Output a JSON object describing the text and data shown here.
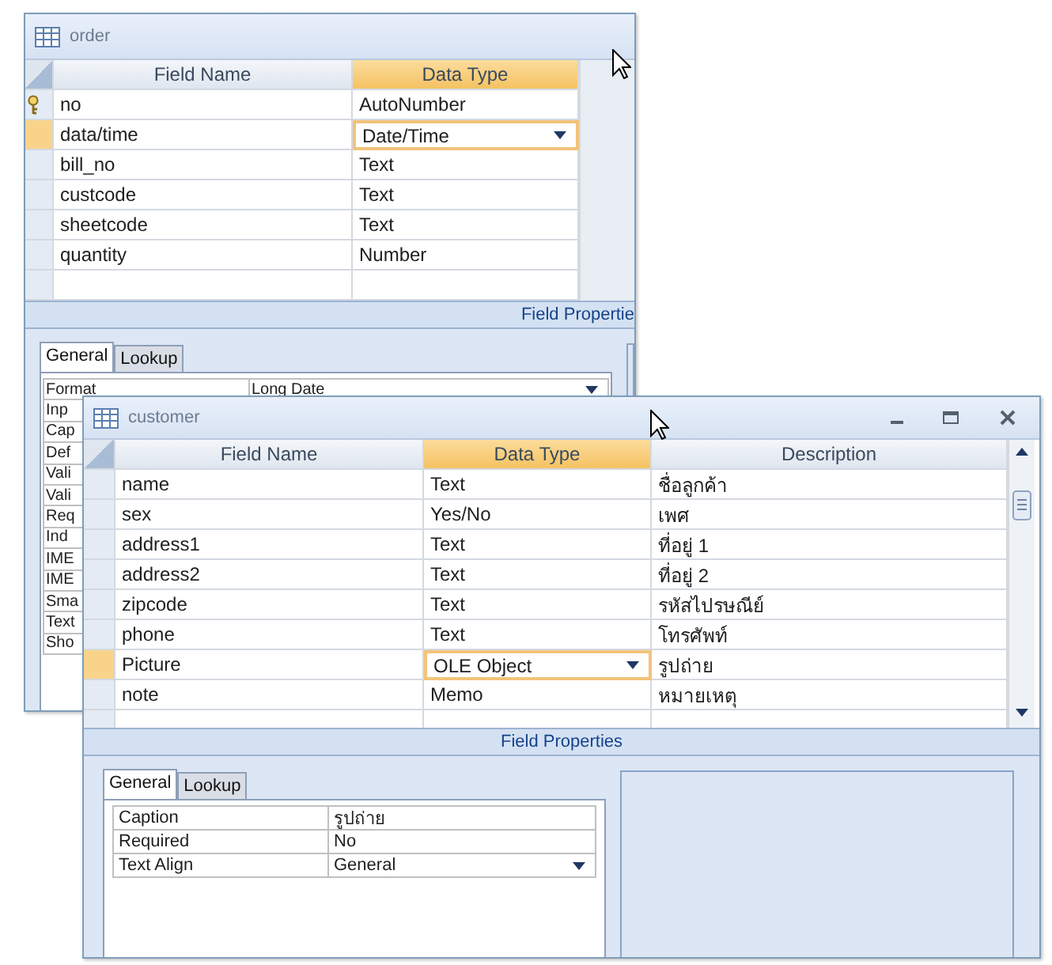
{
  "windows": [
    {
      "title": "order",
      "controls": false,
      "scrollbar": false,
      "pointer": true,
      "columns": [
        {
          "label": "Field Name",
          "selected": false
        },
        {
          "label": "Data Type",
          "selected": true
        }
      ],
      "fields": [
        {
          "name": "no",
          "type": "AutoNumber",
          "primary_key": true,
          "selected": false
        },
        {
          "name": "data/time",
          "type": "Date/Time",
          "primary_key": false,
          "selected": true
        },
        {
          "name": "bill_no",
          "type": "Text",
          "primary_key": false,
          "selected": false
        },
        {
          "name": "custcode",
          "type": "Text",
          "primary_key": false,
          "selected": false
        },
        {
          "name": "sheetcode",
          "type": "Text",
          "primary_key": false,
          "selected": false
        },
        {
          "name": "quantity",
          "type": "Number",
          "primary_key": false,
          "selected": false
        }
      ],
      "properties_title": "Field Propertie",
      "tabs": [
        {
          "label": "General",
          "selected": true
        },
        {
          "label": "Lookup",
          "selected": false
        }
      ],
      "properties": [
        {
          "label": "Format",
          "value": "Long Date",
          "dropdown": true
        },
        {
          "label": "Inp"
        },
        {
          "label": "Cap"
        },
        {
          "label": "Def"
        },
        {
          "label": "Vali"
        },
        {
          "label": "Vali"
        },
        {
          "label": "Req"
        },
        {
          "label": "Ind"
        },
        {
          "label": "IME"
        },
        {
          "label": "IME"
        },
        {
          "label": "Sma"
        },
        {
          "label": "Text"
        },
        {
          "label": "Sho"
        }
      ]
    },
    {
      "title": "customer",
      "controls": true,
      "scrollbar": true,
      "pointer": true,
      "columns": [
        {
          "label": "Field Name",
          "selected": false
        },
        {
          "label": "Data Type",
          "selected": true
        },
        {
          "label": "Description",
          "selected": false
        }
      ],
      "fields": [
        {
          "name": "name",
          "type": "Text",
          "description": "ชื่อลูกค้า",
          "primary_key": false,
          "selected": false
        },
        {
          "name": "sex",
          "type": "Yes/No",
          "description": "เพศ",
          "primary_key": false,
          "selected": false
        },
        {
          "name": "address1",
          "type": "Text",
          "description": "ที่อยู่ 1",
          "primary_key": false,
          "selected": false
        },
        {
          "name": "address2",
          "type": "Text",
          "description": "ที่อยู่ 2",
          "primary_key": false,
          "selected": false
        },
        {
          "name": "zipcode",
          "type": "Text",
          "description": "รหัสไปรษณีย์",
          "primary_key": false,
          "selected": false
        },
        {
          "name": "phone",
          "type": "Text",
          "description": "โทรศัพท์",
          "primary_key": false,
          "selected": false
        },
        {
          "name": "Picture",
          "type": "OLE Object",
          "description": "รูปถ่าย",
          "primary_key": false,
          "selected": true
        },
        {
          "name": "note",
          "type": "Memo",
          "description": "หมายเหตุ",
          "primary_key": false,
          "selected": false
        }
      ],
      "properties_title": "Field Properties",
      "tabs": [
        {
          "label": "General",
          "selected": true
        },
        {
          "label": "Lookup",
          "selected": false
        }
      ],
      "properties": [
        {
          "label": "Caption",
          "value": "รูปถ่าย",
          "dropdown": false
        },
        {
          "label": "Required",
          "value": "No",
          "dropdown": false
        },
        {
          "label": "Text Align",
          "value": "General",
          "dropdown": true
        }
      ]
    }
  ]
}
